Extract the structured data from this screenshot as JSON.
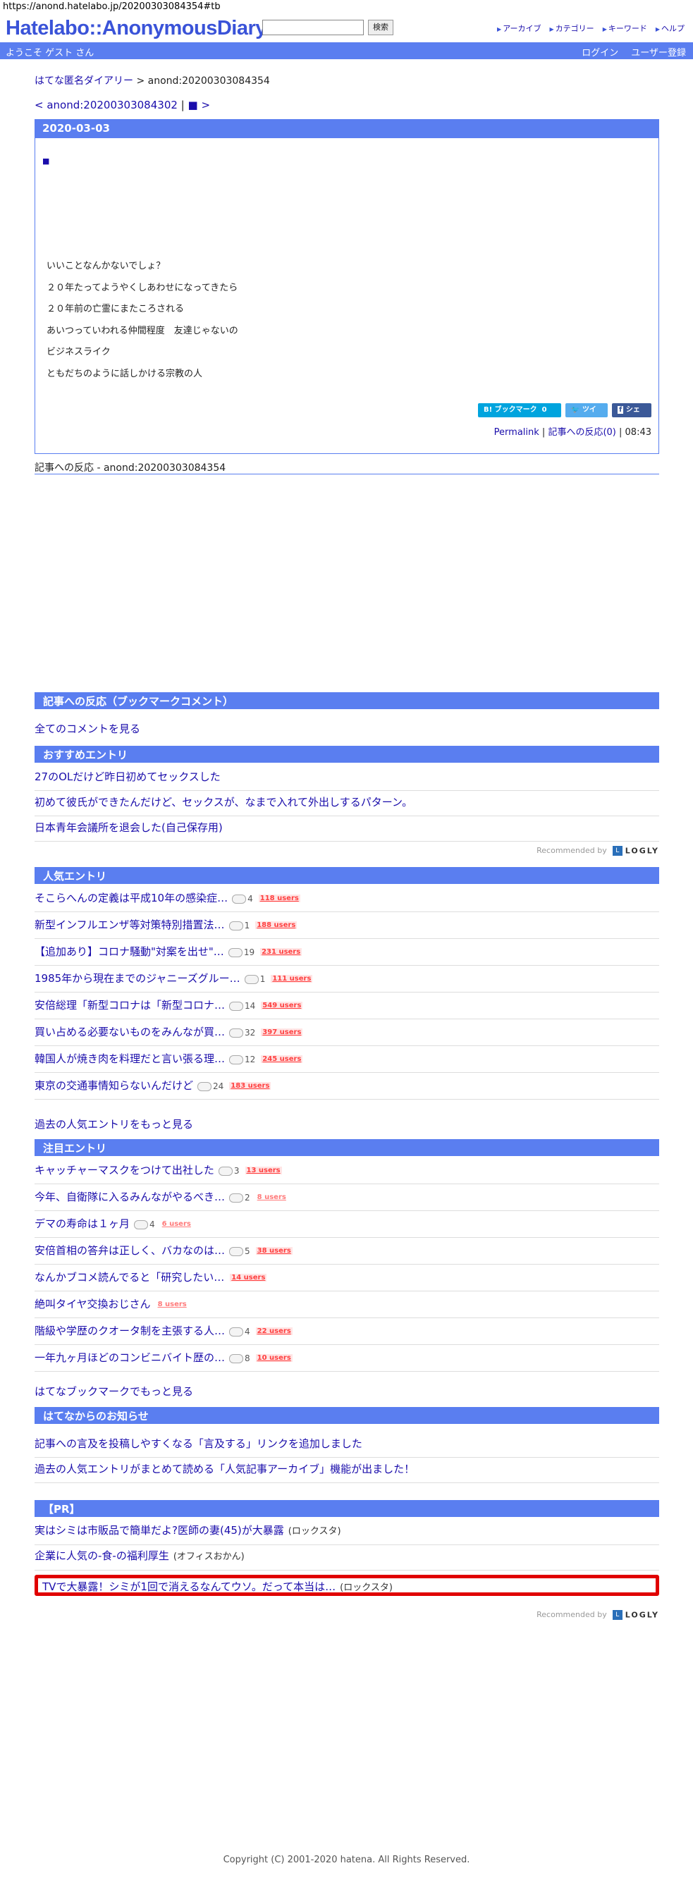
{
  "address": "https://anond.hatelabo.jp/20200303084354#tb",
  "header": {
    "logo": "Hatelabo::AnonymousDiary",
    "search_placeholder": "",
    "search_button": "検索",
    "links": [
      "アーカイブ",
      "カテゴリー",
      "キーワード",
      "ヘルプ"
    ]
  },
  "welcome": {
    "guest": "ようこそ ゲスト さん",
    "login": "ログイン",
    "register": "ユーザー登録"
  },
  "breadcrumb": {
    "home": "はてな匿名ダイアリー",
    "separator": " > ",
    "current": "anond:20200303084354"
  },
  "nav": {
    "prev": "< anond:20200303084302",
    "divider": " | ",
    "next": "■ >"
  },
  "entry": {
    "date": "2020-03-03",
    "mark": "■",
    "lines": [
      "いいことなんかないでしょ？",
      "２０年たってようやくしあわせになってきたら",
      "２０年前の亡霊にまたころされる",
      "あいつっていわれる仲間程度　友達じゃないの",
      "ビジネスライク",
      "ともだちのように話しかける宗教の人"
    ],
    "share": {
      "bookmark": "B! ブックマーク",
      "bookmark_count": "0",
      "tweet": "ツイート",
      "facebook": "シェア"
    },
    "permalink": "Permalink",
    "reactions": "記事への反応(0)",
    "time": "08:43"
  },
  "reaction_title": "記事への反応 - anond:20200303084354",
  "bookmark_section": {
    "title": "記事への反応（ブックマークコメント）",
    "all_comments": "全てのコメントを見る"
  },
  "recommended": {
    "title": "おすすめエントリ",
    "items": [
      "27のOLだけど昨日初めてセックスした",
      "初めて彼氏ができたんだけど、セックスが、なまで入れて外出しするパターン。",
      "日本青年会議所を退会した(自己保存用)"
    ],
    "recommended_by": "Recommended by",
    "logly_text": "LOGLY"
  },
  "popular": {
    "title": "人気エントリ",
    "items": [
      {
        "text": "そこらへんの定義は平成10年の感染症…",
        "comments": "4",
        "users": "118 users"
      },
      {
        "text": "新型インフルエンザ等対策特別措置法…",
        "comments": "1",
        "users": "188 users"
      },
      {
        "text": "【追加あり】コロナ騒動\"対案を出せ\"…",
        "comments": "19",
        "users": "231 users"
      },
      {
        "text": "1985年から現在までのジャニーズグルー…",
        "comments": "1",
        "users": "111 users"
      },
      {
        "text": "安倍総理「新型コロナは「新型コロナ…",
        "comments": "14",
        "users": "549 users"
      },
      {
        "text": "買い占める必要ないものをみんなが買…",
        "comments": "32",
        "users": "397 users"
      },
      {
        "text": "韓国人が焼き肉を料理だと言い張る理…",
        "comments": "12",
        "users": "245 users"
      },
      {
        "text": "東京の交通事情知らないんだけど",
        "comments": "24",
        "users": "183 users"
      }
    ],
    "more": "過去の人気エントリをもっと見る"
  },
  "attention": {
    "title": "注目エントリ",
    "items": [
      {
        "text": "キャッチャーマスクをつけて出社した",
        "comments": "3",
        "users": "13 users"
      },
      {
        "text": "今年、自衛隊に入るみんながやるべき…",
        "comments": "2",
        "users": "8 users"
      },
      {
        "text": "デマの寿命は１ヶ月",
        "comments": "4",
        "users": "6 users"
      },
      {
        "text": "安倍首相の答弁は正しく、バカなのは…",
        "comments": "5",
        "users": "38 users"
      },
      {
        "text": "なんかブコメ読んでると「研究したい…",
        "comments": "",
        "users": "14 users"
      },
      {
        "text": "絶叫タイヤ交換おじさん",
        "comments": "",
        "users": "8 users"
      },
      {
        "text": "階級や学歴のクオータ制を主張する人…",
        "comments": "4",
        "users": "22 users"
      },
      {
        "text": "一年九ヶ月ほどのコンビニバイト歴の…",
        "comments": "8",
        "users": "10 users"
      }
    ],
    "more": "はてなブックマークでもっと見る"
  },
  "notices": {
    "title": "はてなからのお知らせ",
    "items": [
      "記事への言及を投稿しやすくなる「言及する」リンクを追加しました",
      "過去の人気エントリがまとめて読める「人気記事アーカイブ」機能が出ました！"
    ]
  },
  "pr": {
    "title": "【PR】",
    "items": [
      {
        "text": "実はシミは市販品で簡単だよ?医師の妻(45)が大暴露",
        "source": "ロックスタ"
      },
      {
        "text": "企業に人気の-食-の福利厚生",
        "source": "オフィスおかん"
      },
      {
        "text": "TVで大暴露！シミが1回で消えるなんてウソ。だって本当は…",
        "source": "ロックスタ"
      }
    ]
  },
  "copyright": "Copyright (C) 2001-2020 hatena. All Rights Reserved.",
  "colors": {
    "accent": "#5a7ef0",
    "pr_highlight": "#e00000"
  }
}
